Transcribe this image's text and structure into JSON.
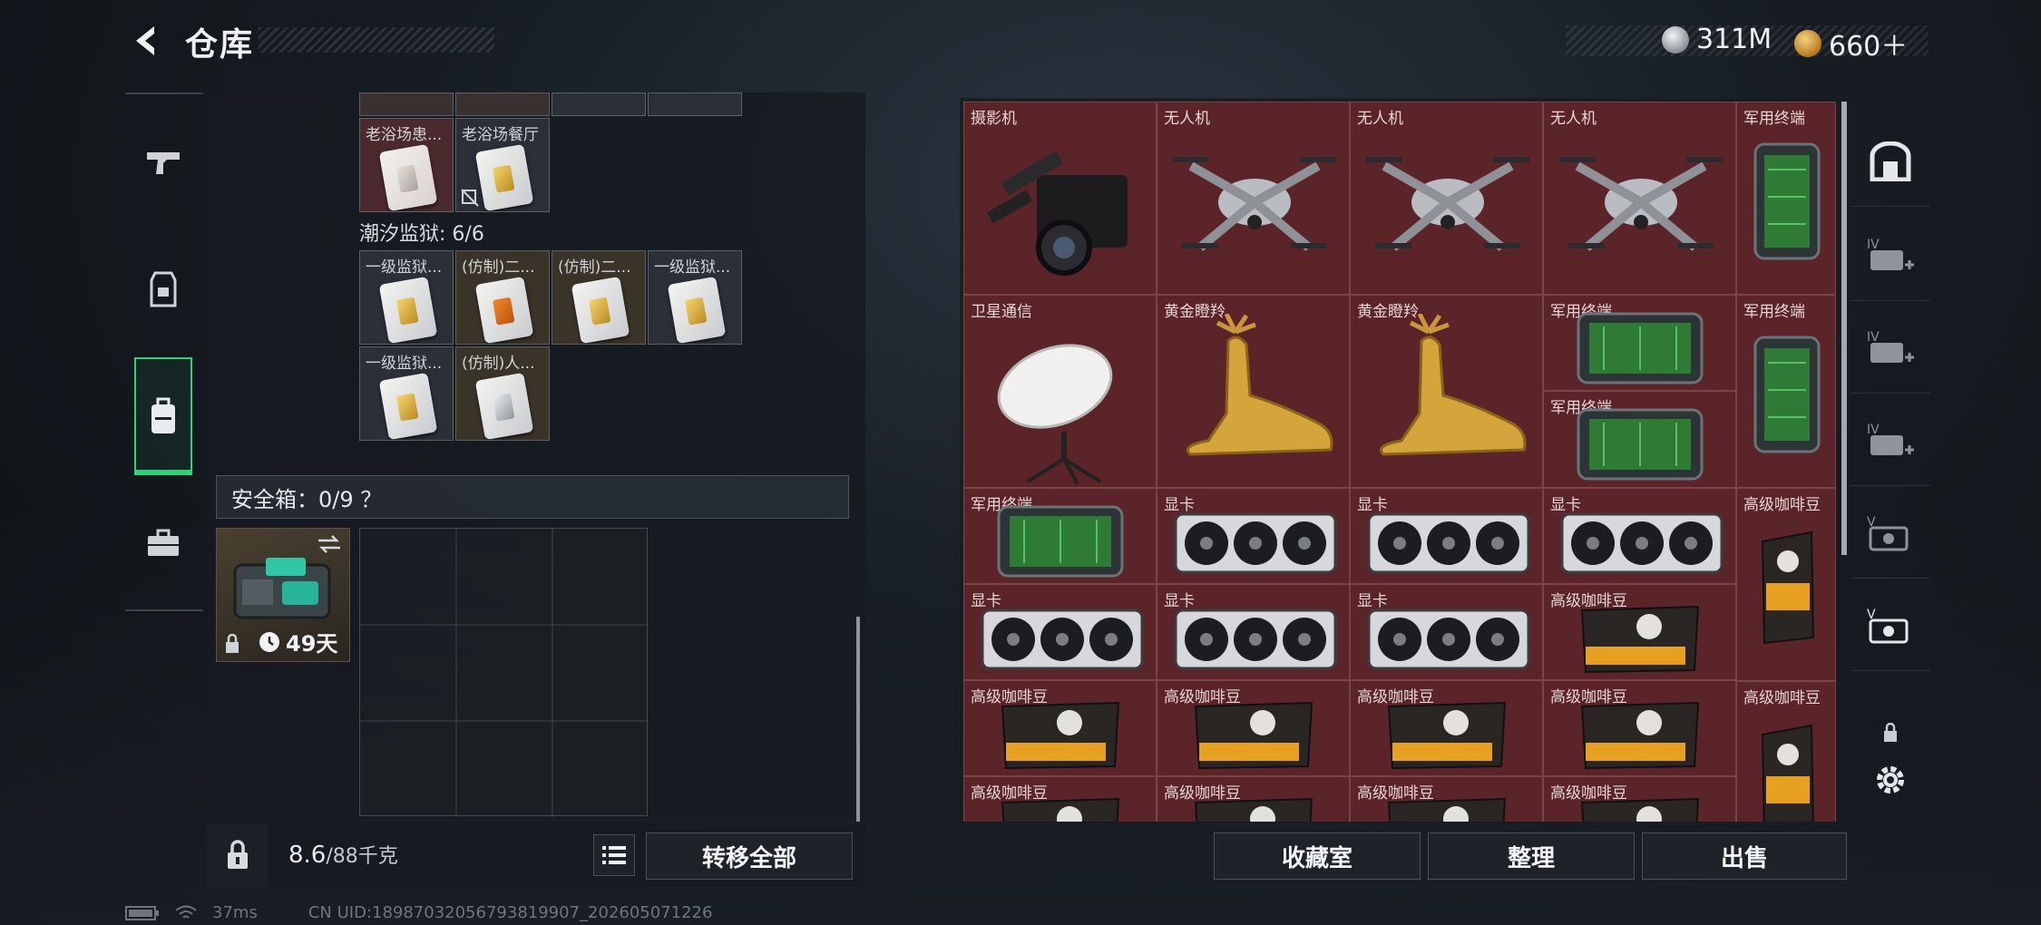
{
  "header": {
    "title": "仓库",
    "currency_1": "311M",
    "currency_2": "660＋"
  },
  "left_panel": {
    "top_items": [
      {
        "label": "老浴场患..."
      },
      {
        "label": "老浴场餐厅"
      }
    ],
    "prison_section": "潮汐监狱: 6/6",
    "prison_items": [
      {
        "label": "一级监狱..."
      },
      {
        "label": "(仿制)二..."
      },
      {
        "label": "(仿制)二..."
      },
      {
        "label": "一级监狱..."
      },
      {
        "label": "一级监狱..."
      },
      {
        "label": "(仿制)人..."
      }
    ],
    "safebox_label": "安全箱：0/9 ？",
    "safebox_timer": "49天",
    "weight_value": "8.6",
    "weight_max": "/88千克",
    "transfer_all": "转移全部"
  },
  "right_panel": {
    "items": [
      {
        "label": "摄影机"
      },
      {
        "label": "无人机"
      },
      {
        "label": "无人机"
      },
      {
        "label": "无人机"
      },
      {
        "label": "军用终端"
      },
      {
        "label": "卫星通信"
      },
      {
        "label": "黄金瞪羚"
      },
      {
        "label": "黄金瞪羚"
      },
      {
        "label": "军用终端"
      },
      {
        "label": "军用终端"
      },
      {
        "label": "军用终端"
      },
      {
        "label": "军用终端"
      },
      {
        "label": "显卡"
      },
      {
        "label": "显卡"
      },
      {
        "label": "显卡"
      },
      {
        "label": "高级咖啡豆"
      },
      {
        "label": "显卡"
      },
      {
        "label": "显卡"
      },
      {
        "label": "显卡"
      },
      {
        "label": "高级咖啡豆"
      },
      {
        "label": "高级咖啡豆"
      },
      {
        "label": "高级咖啡豆"
      },
      {
        "label": "高级咖啡豆"
      },
      {
        "label": "高级咖啡豆"
      },
      {
        "label": "高级咖啡豆"
      },
      {
        "label": "高级咖啡豆"
      },
      {
        "label": "高级咖啡豆"
      },
      {
        "label": "高级咖啡豆"
      },
      {
        "label": "高级咖啡豆"
      }
    ],
    "btn_collection": "收藏室",
    "btn_sort": "整理",
    "btn_sell": "出售"
  },
  "status": {
    "ping": "37ms",
    "uid": "CN UID:18987032056793819907_202605071226"
  },
  "colors": {
    "accent": "#2fd07a",
    "item_bg": "#5a2428",
    "gold": "#d4a53a"
  }
}
